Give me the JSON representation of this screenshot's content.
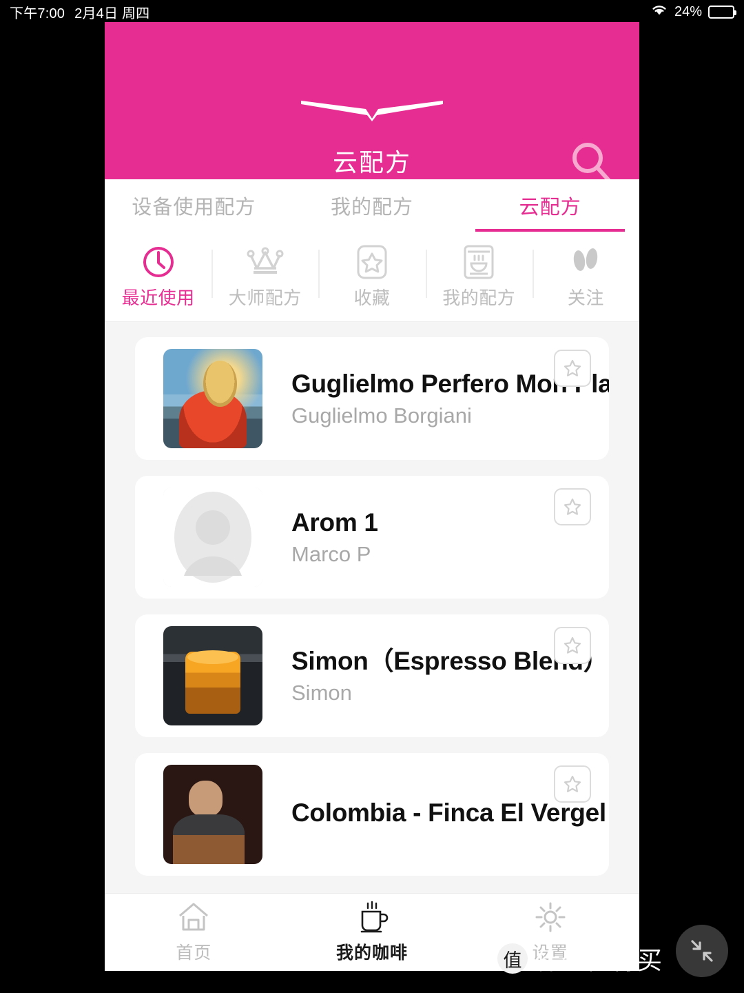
{
  "status_bar": {
    "time": "下午7:00",
    "date": "2月4日 周四",
    "battery_percent": "24%",
    "battery_level": 24,
    "wifi_icon": "wifi-icon"
  },
  "header": {
    "title": "云配方",
    "logo_icon": "brand-wing-logo",
    "search_icon": "search-icon",
    "background_color": "#E62D92"
  },
  "tabs": [
    {
      "label": "设备使用配方",
      "active": false
    },
    {
      "label": "我的配方",
      "active": false
    },
    {
      "label": "云配方",
      "active": true
    }
  ],
  "subtabs": [
    {
      "label": "最近使用",
      "icon": "clock-icon",
      "active": true
    },
    {
      "label": "大师配方",
      "icon": "crown-icon",
      "active": false
    },
    {
      "label": "收藏",
      "icon": "star-outline-icon",
      "active": false
    },
    {
      "label": "我的配方",
      "icon": "coffee-machine-icon",
      "active": false
    },
    {
      "label": "关注",
      "icon": "footprints-icon",
      "active": false
    }
  ],
  "recipes": [
    {
      "title": "Guglielmo Perfero Mon Plaisir",
      "author": "Guglielmo Borgiani",
      "thumb": "photo-woman-sailboat",
      "favorite_icon": "star-bookmark-icon"
    },
    {
      "title": "Arom 1",
      "author": "Marco P",
      "thumb": "default-avatar",
      "favorite_icon": "star-bookmark-icon"
    },
    {
      "title": "Simon（Espresso Blend）",
      "author": "Simon",
      "thumb": "photo-espresso-extraction",
      "favorite_icon": "star-bookmark-icon"
    },
    {
      "title": "Colombia - Finca El Vergel - Java Natural",
      "author": "",
      "thumb": "photo-barista-man",
      "favorite_icon": "star-bookmark-icon"
    }
  ],
  "bottom_nav": [
    {
      "label": "首页",
      "icon": "home-icon",
      "active": false
    },
    {
      "label": "我的咖啡",
      "icon": "coffee-cup-icon",
      "active": true
    },
    {
      "label": "设置",
      "icon": "gear-icon",
      "active": false
    }
  ],
  "overlay": {
    "float_button_icon": "collapse-arrows-icon",
    "watermark_logo": "值",
    "watermark_text": "什么值得买"
  }
}
